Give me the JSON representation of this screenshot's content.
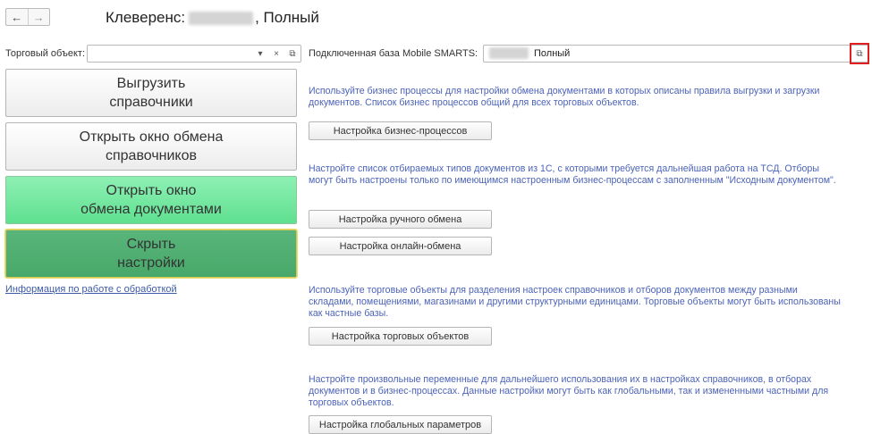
{
  "header": {
    "back_icon": "←",
    "forward_icon": "→",
    "title_prefix": "Клеверенс:",
    "title_suffix": ", Полный"
  },
  "trade_object": {
    "label": "Торговый объект:",
    "value": "",
    "dropdown_icon": "▾",
    "clear_icon": "×",
    "open_icon": "⧉"
  },
  "mobile_db": {
    "label": "Подключенная база Mobile SMARTS:",
    "value": "Полный",
    "open_icon": "⧉"
  },
  "left_buttons": {
    "export": "Выгрузить\nсправочники",
    "open_catalogs": "Открыть окно обмена\nсправочников",
    "open_documents": "Открыть окно\nобмена документами",
    "hide_settings": "Скрыть\nнастройки"
  },
  "info_link": "Информация по работе с обработкой",
  "sections": [
    {
      "description": "Используйте бизнес процессы для настройки обмена документами в которых описаны правила выгрузки и загрузки документов. Список бизнес процессов общий для всех торговых объектов.",
      "buttons": [
        "Настройка бизнес-процессов"
      ]
    },
    {
      "description": "Настройте список отбираемых типов документов из 1С, с которыми требуется дальнейшая работа на ТСД. Отборы могут быть настроены только по имеющимся настроенным бизнес-процессам с заполненным \"Исходным документом\".",
      "buttons": [
        "Настройка ручного обмена",
        "Настройка онлайн-обмена"
      ]
    },
    {
      "description": "Используйте торговые объекты для разделения настроек справочников и отборов документов между разными складами, помещениями, магазинами и другими структурными единицами. Торговые объекты могут быть использованы как частные базы.",
      "buttons": [
        "Настройка торговых объектов"
      ]
    },
    {
      "description": "Настройте произвольные переменные для дальнейшего использования их в настройках справочников, в отборах документов и в бизнес-процессах. Данные настройки могут быть как глобальными, так и измененными частными для торговых объектов.",
      "buttons": [
        "Настройка глобальных параметров"
      ]
    }
  ]
}
